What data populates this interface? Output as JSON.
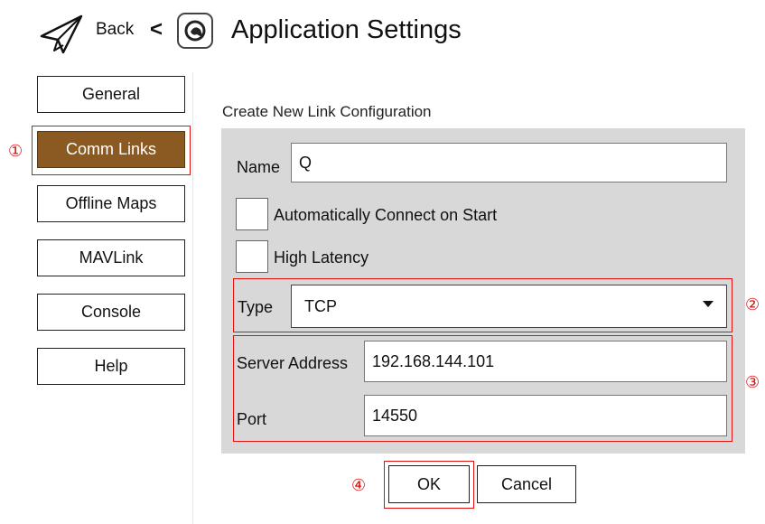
{
  "header": {
    "back_label": "Back",
    "chevron": "<",
    "logo_icon": "qgc-logo-icon",
    "back_icon": "paper-plane-icon",
    "title": "Application Settings"
  },
  "sidebar": {
    "items": [
      {
        "label": "General",
        "active": false
      },
      {
        "label": "Comm Links",
        "active": true
      },
      {
        "label": "Offline Maps",
        "active": false
      },
      {
        "label": "MAVLink",
        "active": false
      },
      {
        "label": "Console",
        "active": false
      },
      {
        "label": "Help",
        "active": false
      }
    ]
  },
  "form": {
    "section_title": "Create New Link Configuration",
    "name_label": "Name",
    "name_value": "Q",
    "auto_connect_label": "Automatically Connect on Start",
    "auto_connect_checked": false,
    "high_latency_label": "High Latency",
    "high_latency_checked": false,
    "type_label": "Type",
    "type_value": "TCP",
    "server_label": "Server Address",
    "server_value": "192.168.144.101",
    "port_label": "Port",
    "port_value": "14550"
  },
  "actions": {
    "ok_label": "OK",
    "cancel_label": "Cancel"
  },
  "annotations": {
    "one": "①",
    "two": "②",
    "three": "③",
    "four": "④",
    "highlight_color": "#e01010"
  },
  "colors": {
    "active_tab": "#8a5a22",
    "panel_bg": "#d8d8d8"
  }
}
